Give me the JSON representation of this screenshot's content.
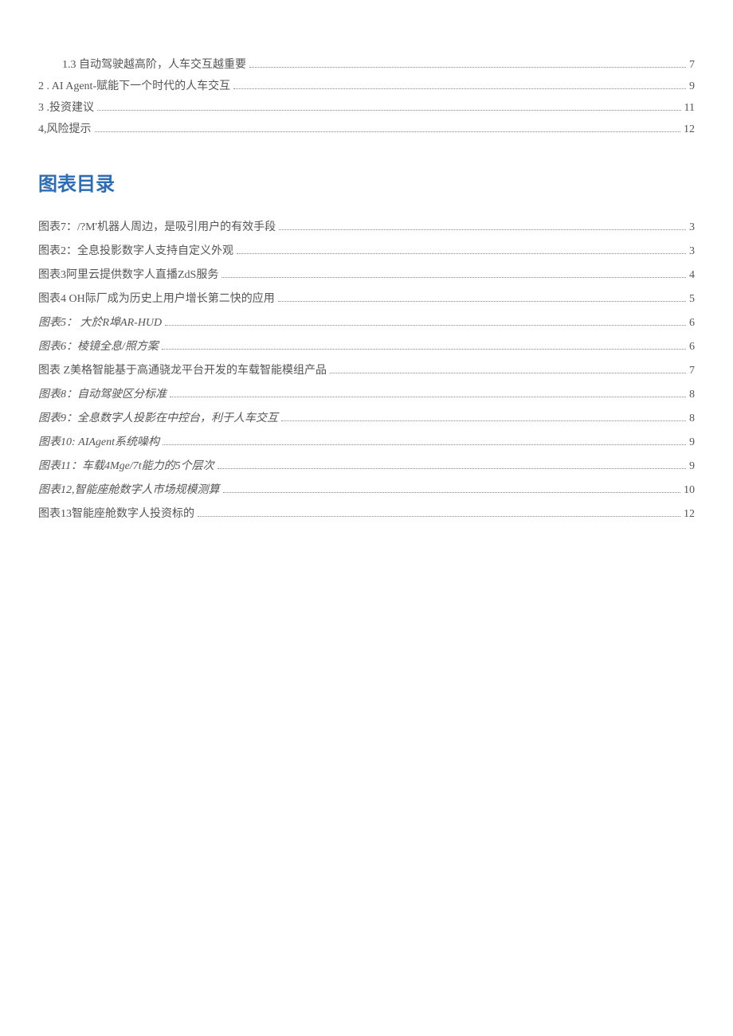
{
  "content_toc": [
    {
      "label": "1.3   自动驾驶越高阶，人车交互越重要",
      "page": "7",
      "indent": true
    },
    {
      "label": "2   . AI Agent-赋能下一个时代的人车交互",
      "page": "9",
      "indent": false
    },
    {
      "label": "3   .投资建议",
      "page": "11",
      "indent": false
    },
    {
      "label": "4,风险提示",
      "page": "12",
      "indent": false
    }
  ],
  "figures_title": "图表目录",
  "figures_toc": [
    {
      "label": "图表7：/?M'机器人周边，是吸引用户的有效手段",
      "page": "3"
    },
    {
      "label": "图表2：全息投影数字人支持自定义外观",
      "page": "3"
    },
    {
      "label": "图表3阿里云提供数字人直播ZdS服务",
      "page": "4"
    },
    {
      "label": "图表4 OH际厂成为历史上用户增长第二快的应用",
      "page": "5"
    },
    {
      "label": "图表5： 大於R埠AR-HUD",
      "page": "6",
      "italic": true
    },
    {
      "label": "图表6：棱镜全息/照方案",
      "page": "6",
      "italic": true
    },
    {
      "label": "图表  Z美格智能基于高通骁龙平台开发的车载智能模组产品",
      "page": "7"
    },
    {
      "label": "图表8：自动驾驶区分标准",
      "page": "8",
      "italic": true
    },
    {
      "label": "图表9：全息数字人投影在中控台，利于人车交互",
      "page": "8",
      "italic": true
    },
    {
      "label": "图表10:   AIAgent系统噪构",
      "page": "9",
      "italic": true
    },
    {
      "label": "图表11：车载4Mge/7t能力的5个层次",
      "page": "9",
      "italic": true
    },
    {
      "label": "图表12,智能座舱数字人市场规模测算",
      "page": "10",
      "italic": true
    },
    {
      "label": "图表13智能座舱数字人投资标的",
      "page": "12"
    }
  ]
}
